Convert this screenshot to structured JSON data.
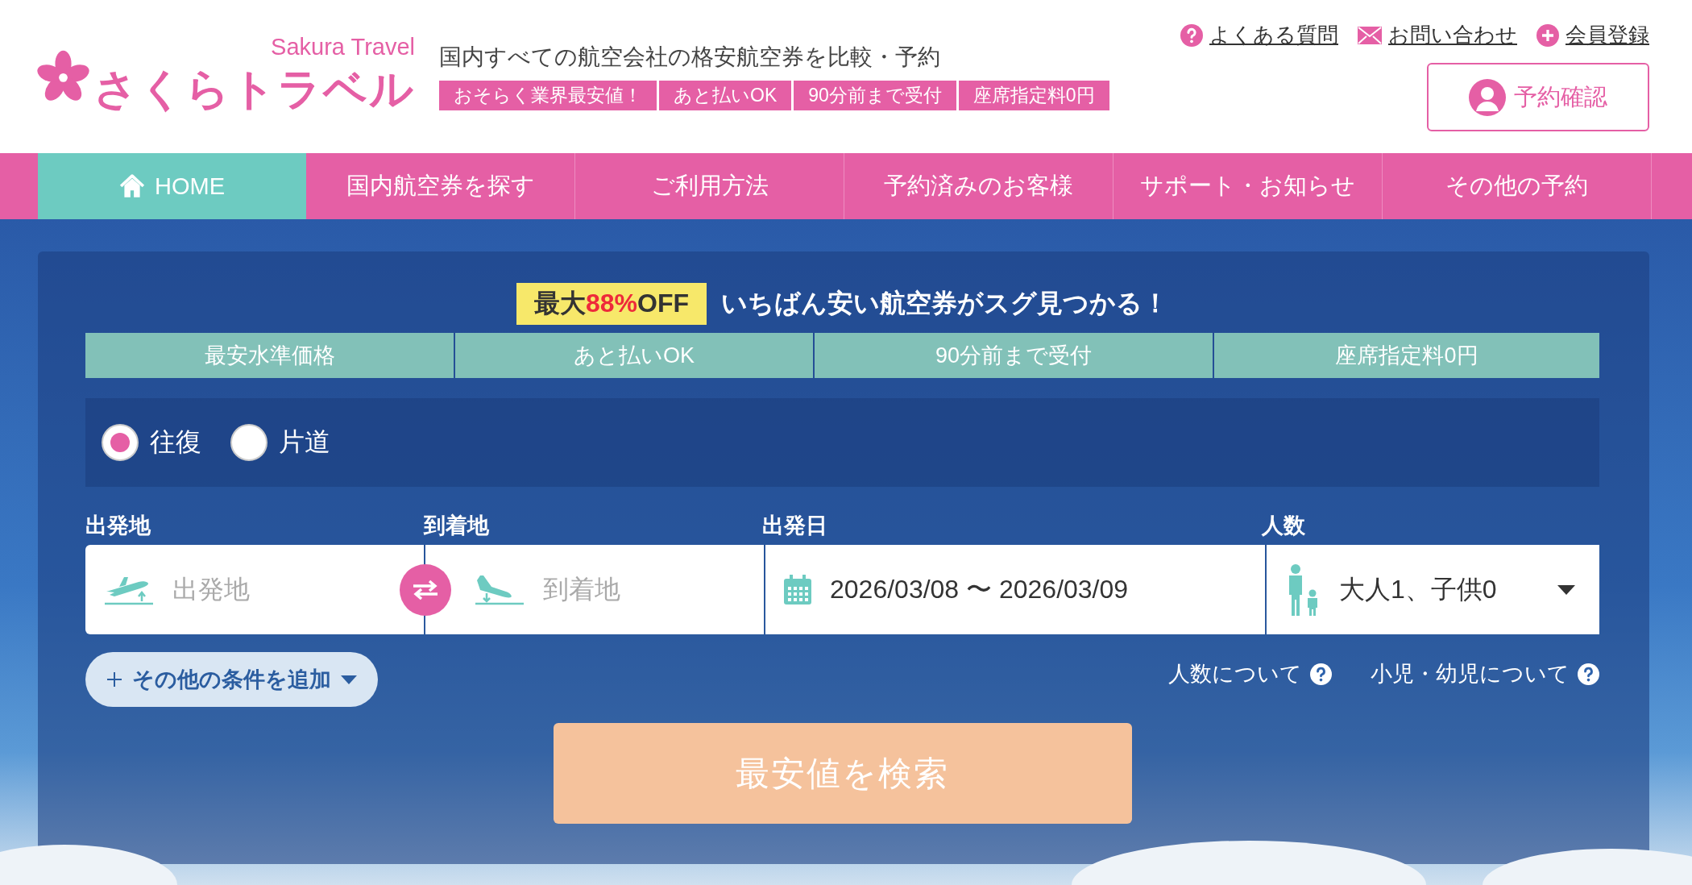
{
  "logo": {
    "name": "さくらトラベル",
    "tagline": "Sakura Travel"
  },
  "header": {
    "title": "国内すべての航空会社の格安航空券を比較・予約",
    "badges": [
      "おそらく業界最安値！",
      "あと払いOK",
      "90分前まで受付",
      "座席指定料0円"
    ]
  },
  "top_links": [
    {
      "label": "よくある質問",
      "kind": "question"
    },
    {
      "label": "お問い合わせ",
      "kind": "mail"
    },
    {
      "label": "会員登録",
      "kind": "plus"
    }
  ],
  "reservation_button": "予約確認",
  "nav": [
    {
      "label": "HOME",
      "kind": "home",
      "selected": true
    },
    {
      "label": "国内航空券を探す",
      "kind": "page",
      "selected": false
    },
    {
      "label": "ご利用方法",
      "kind": "page",
      "selected": false
    },
    {
      "label": "予約済みのお客様",
      "kind": "page",
      "selected": false
    },
    {
      "label": "サポート・お知らせ",
      "kind": "page",
      "selected": false
    },
    {
      "label": "その他の予約",
      "kind": "page",
      "selected": false
    }
  ],
  "promo": {
    "prefix": "最大",
    "highlight": "88%",
    "suffix": "OFF",
    "text": "いちばん安い航空券がスグ見つかる！"
  },
  "features": [
    "最安水準価格",
    "あと払いOK",
    "90分前まで受付",
    "座席指定料0円"
  ],
  "trip_types": [
    {
      "label": "往復",
      "selected": true
    },
    {
      "label": "片道",
      "selected": false
    }
  ],
  "fields": [
    {
      "kind": "origin",
      "label": "出発地",
      "placeholder": "出発地"
    },
    {
      "kind": "destination",
      "label": "到着地",
      "placeholder": "到着地"
    },
    {
      "kind": "dates",
      "label": "出発日",
      "value": "2026/03/08 〜 2026/03/09"
    },
    {
      "kind": "passengers",
      "label": "人数",
      "value": "大人1、子供0"
    }
  ],
  "add_conditions": "その他の条件を追加",
  "help_links": [
    "人数について",
    "小児・幼児について"
  ],
  "search_button": "最安値を検索"
}
